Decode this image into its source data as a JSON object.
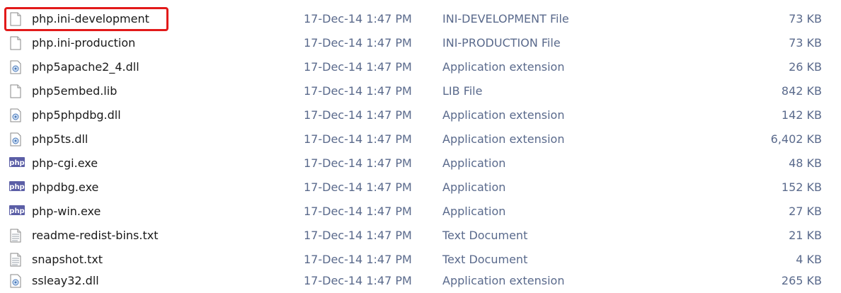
{
  "files": [
    {
      "name": "php.ini-development",
      "date": "17-Dec-14 1:47 PM",
      "type": "INI-DEVELOPMENT File",
      "size": "73 KB",
      "icon": "file-icon"
    },
    {
      "name": "php.ini-production",
      "date": "17-Dec-14 1:47 PM",
      "type": "INI-PRODUCTION File",
      "size": "73 KB",
      "icon": "file-icon"
    },
    {
      "name": "php5apache2_4.dll",
      "date": "17-Dec-14 1:47 PM",
      "type": "Application extension",
      "size": "26 KB",
      "icon": "dll-icon"
    },
    {
      "name": "php5embed.lib",
      "date": "17-Dec-14 1:47 PM",
      "type": "LIB File",
      "size": "842 KB",
      "icon": "file-icon"
    },
    {
      "name": "php5phpdbg.dll",
      "date": "17-Dec-14 1:47 PM",
      "type": "Application extension",
      "size": "142 KB",
      "icon": "dll-icon"
    },
    {
      "name": "php5ts.dll",
      "date": "17-Dec-14 1:47 PM",
      "type": "Application extension",
      "size": "6,402 KB",
      "icon": "dll-icon"
    },
    {
      "name": "php-cgi.exe",
      "date": "17-Dec-14 1:47 PM",
      "type": "Application",
      "size": "48 KB",
      "icon": "php-exe-icon"
    },
    {
      "name": "phpdbg.exe",
      "date": "17-Dec-14 1:47 PM",
      "type": "Application",
      "size": "152 KB",
      "icon": "php-exe-icon"
    },
    {
      "name": "php-win.exe",
      "date": "17-Dec-14 1:47 PM",
      "type": "Application",
      "size": "27 KB",
      "icon": "php-exe-icon"
    },
    {
      "name": "readme-redist-bins.txt",
      "date": "17-Dec-14 1:47 PM",
      "type": "Text Document",
      "size": "21 KB",
      "icon": "text-file-icon"
    },
    {
      "name": "snapshot.txt",
      "date": "17-Dec-14 1:47 PM",
      "type": "Text Document",
      "size": "4 KB",
      "icon": "text-file-icon"
    },
    {
      "name": "ssleay32.dll",
      "date": "17-Dec-14 1:47 PM",
      "type": "Application extension",
      "size": "265 KB",
      "icon": "dll-icon"
    }
  ],
  "highlighted_index": 0,
  "colors": {
    "highlight": "#e21a1a",
    "php_icon": "#5b5ea6"
  }
}
